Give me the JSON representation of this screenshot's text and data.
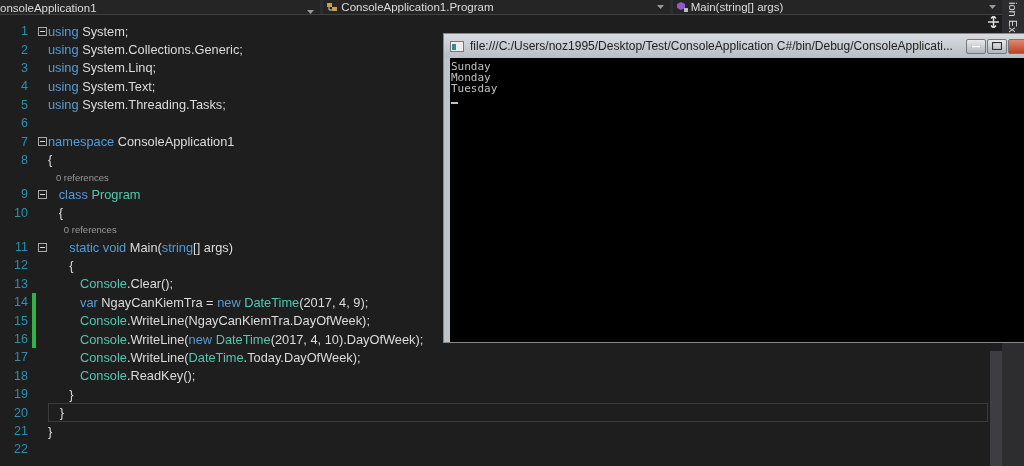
{
  "nav_bar": {
    "project": "onsoleApplication1",
    "class": "ConsoleApplication1.Program",
    "member": "Main(string[] args)"
  },
  "editor": {
    "lines": [
      {
        "kind": "code",
        "number": "1",
        "fold": true,
        "changed": false,
        "current": false,
        "tokens": [
          {
            "kind": "kw",
            "text": "using"
          },
          {
            "kind": "plain",
            "text": " System;"
          }
        ]
      },
      {
        "kind": "code",
        "number": "2",
        "fold": false,
        "changed": false,
        "current": false,
        "tokens": [
          {
            "kind": "kw",
            "text": "using"
          },
          {
            "kind": "plain",
            "text": " System.Collections.Generic;"
          }
        ]
      },
      {
        "kind": "code",
        "number": "3",
        "fold": false,
        "changed": false,
        "current": false,
        "tokens": [
          {
            "kind": "kw",
            "text": "using"
          },
          {
            "kind": "plain",
            "text": " System.Linq;"
          }
        ]
      },
      {
        "kind": "code",
        "number": "4",
        "fold": false,
        "changed": false,
        "current": false,
        "tokens": [
          {
            "kind": "kw",
            "text": "using"
          },
          {
            "kind": "plain",
            "text": " System.Text;"
          }
        ]
      },
      {
        "kind": "code",
        "number": "5",
        "fold": false,
        "changed": false,
        "current": false,
        "tokens": [
          {
            "kind": "kw",
            "text": "using"
          },
          {
            "kind": "plain",
            "text": " System.Threading.Tasks;"
          }
        ]
      },
      {
        "kind": "code",
        "number": "6",
        "fold": false,
        "changed": false,
        "current": false
      },
      {
        "kind": "code",
        "number": "7",
        "fold": true,
        "changed": false,
        "current": false,
        "tokens": [
          {
            "kind": "kw",
            "text": "namespace"
          },
          {
            "kind": "plain",
            "text": " ConsoleApplication1"
          }
        ]
      },
      {
        "kind": "code",
        "number": "8",
        "fold": false,
        "changed": false,
        "current": false,
        "tokens": [
          {
            "kind": "plain",
            "text": "{"
          }
        ]
      },
      {
        "kind": "codelens",
        "text": "   0 references"
      },
      {
        "kind": "code",
        "number": "9",
        "fold": true,
        "changed": false,
        "current": false,
        "tokens": [
          {
            "kind": "kw",
            "text": "   class"
          },
          {
            "kind": "type",
            "text": " Program"
          }
        ]
      },
      {
        "kind": "code",
        "number": "10",
        "fold": false,
        "changed": false,
        "current": false,
        "tokens": [
          {
            "kind": "plain",
            "text": "   {"
          }
        ]
      },
      {
        "kind": "codelens",
        "text": "      0 references"
      },
      {
        "kind": "code",
        "number": "11",
        "fold": true,
        "changed": false,
        "current": false,
        "tokens": [
          {
            "kind": "kw",
            "text": "      static void"
          },
          {
            "kind": "plain",
            "text": " Main("
          },
          {
            "kind": "kw",
            "text": "string"
          },
          {
            "kind": "plain",
            "text": "[] args)"
          }
        ]
      },
      {
        "kind": "code",
        "number": "12",
        "fold": false,
        "changed": false,
        "current": false,
        "tokens": [
          {
            "kind": "plain",
            "text": "      {"
          }
        ]
      },
      {
        "kind": "code",
        "number": "13",
        "fold": false,
        "changed": false,
        "current": false,
        "tokens": [
          {
            "kind": "type",
            "text": "         Console"
          },
          {
            "kind": "plain",
            "text": ".Clear();"
          }
        ]
      },
      {
        "kind": "code",
        "number": "14",
        "fold": false,
        "changed": true,
        "current": false,
        "tokens": [
          {
            "kind": "kw",
            "text": "         var"
          },
          {
            "kind": "plain",
            "text": " NgayCanKiemTra = "
          },
          {
            "kind": "kw",
            "text": "new"
          },
          {
            "kind": "type",
            "text": " DateTime"
          },
          {
            "kind": "plain",
            "text": "(2017, 4, 9);"
          }
        ]
      },
      {
        "kind": "code",
        "number": "15",
        "fold": false,
        "changed": true,
        "current": false,
        "tokens": [
          {
            "kind": "type",
            "text": "         Console"
          },
          {
            "kind": "plain",
            "text": ".WriteLine(NgayCanKiemTra.DayOfWeek);"
          }
        ]
      },
      {
        "kind": "code",
        "number": "16",
        "fold": false,
        "changed": true,
        "current": false,
        "tokens": [
          {
            "kind": "type",
            "text": "         Console"
          },
          {
            "kind": "plain",
            "text": ".WriteLine("
          },
          {
            "kind": "kw",
            "text": "new"
          },
          {
            "kind": "type",
            "text": " DateTime"
          },
          {
            "kind": "plain",
            "text": "(2017, 4, 10).DayOfWeek);"
          }
        ]
      },
      {
        "kind": "code",
        "number": "17",
        "fold": false,
        "changed": false,
        "current": false,
        "tokens": [
          {
            "kind": "type",
            "text": "         Console"
          },
          {
            "kind": "plain",
            "text": ".WriteLine("
          },
          {
            "kind": "type",
            "text": "DateTime"
          },
          {
            "kind": "plain",
            "text": ".Today.DayOfWeek);"
          }
        ]
      },
      {
        "kind": "code",
        "number": "18",
        "fold": false,
        "changed": false,
        "current": false,
        "tokens": [
          {
            "kind": "type",
            "text": "         Console"
          },
          {
            "kind": "plain",
            "text": ".ReadKey();"
          }
        ]
      },
      {
        "kind": "code",
        "number": "19",
        "fold": false,
        "changed": false,
        "current": false,
        "tokens": [
          {
            "kind": "plain",
            "text": "      }"
          }
        ]
      },
      {
        "kind": "code",
        "number": "20",
        "fold": false,
        "changed": false,
        "current": true,
        "tokens": [
          {
            "kind": "plain",
            "text": "   }"
          }
        ]
      },
      {
        "kind": "code",
        "number": "21",
        "fold": false,
        "changed": false,
        "current": false,
        "tokens": [
          {
            "kind": "plain",
            "text": "}"
          }
        ]
      },
      {
        "kind": "code",
        "number": "22",
        "fold": false,
        "changed": false,
        "current": false
      }
    ]
  },
  "side_panel": {
    "tab": "ion Ex"
  },
  "console_window": {
    "title": "file:///C:/Users/noz1995/Desktop/Test/ConsoleApplication C#/bin/Debug/ConsoleApplicati...",
    "output": [
      "Sunday",
      "Monday",
      "Tuesday"
    ]
  }
}
